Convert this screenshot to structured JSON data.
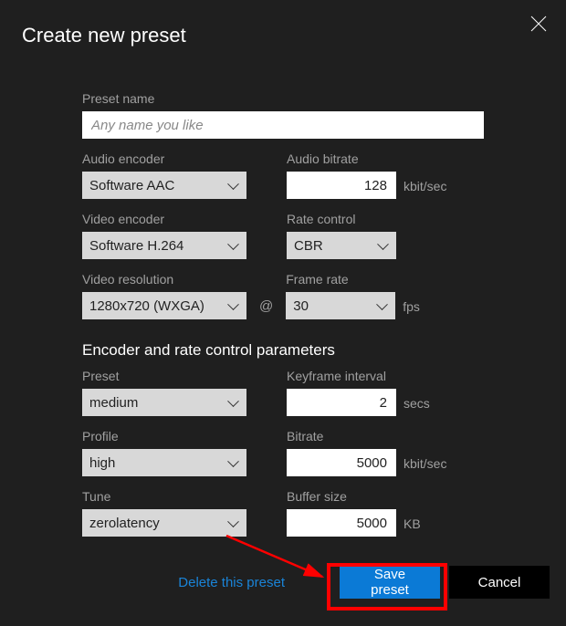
{
  "title": "Create new preset",
  "preset_name": {
    "label": "Preset name",
    "placeholder": "Any name you like"
  },
  "audio_encoder": {
    "label": "Audio encoder",
    "value": "Software AAC"
  },
  "audio_bitrate": {
    "label": "Audio bitrate",
    "value": "128",
    "unit": "kbit/sec"
  },
  "video_encoder": {
    "label": "Video encoder",
    "value": "Software H.264"
  },
  "rate_control": {
    "label": "Rate control",
    "value": "CBR"
  },
  "video_resolution": {
    "label": "Video resolution",
    "value": "1280x720 (WXGA)"
  },
  "at": "@",
  "frame_rate": {
    "label": "Frame rate",
    "value": "30",
    "unit": "fps"
  },
  "section_header": "Encoder and rate control parameters",
  "preset": {
    "label": "Preset",
    "value": "medium"
  },
  "keyframe": {
    "label": "Keyframe interval",
    "value": "2",
    "unit": "secs"
  },
  "profile": {
    "label": "Profile",
    "value": "high"
  },
  "bitrate": {
    "label": "Bitrate",
    "value": "5000",
    "unit": "kbit/sec"
  },
  "tune": {
    "label": "Tune",
    "value": "zerolatency"
  },
  "buffer": {
    "label": "Buffer size",
    "value": "5000",
    "unit": "KB"
  },
  "footer": {
    "delete": "Delete this preset",
    "save": "Save preset",
    "cancel": "Cancel"
  }
}
